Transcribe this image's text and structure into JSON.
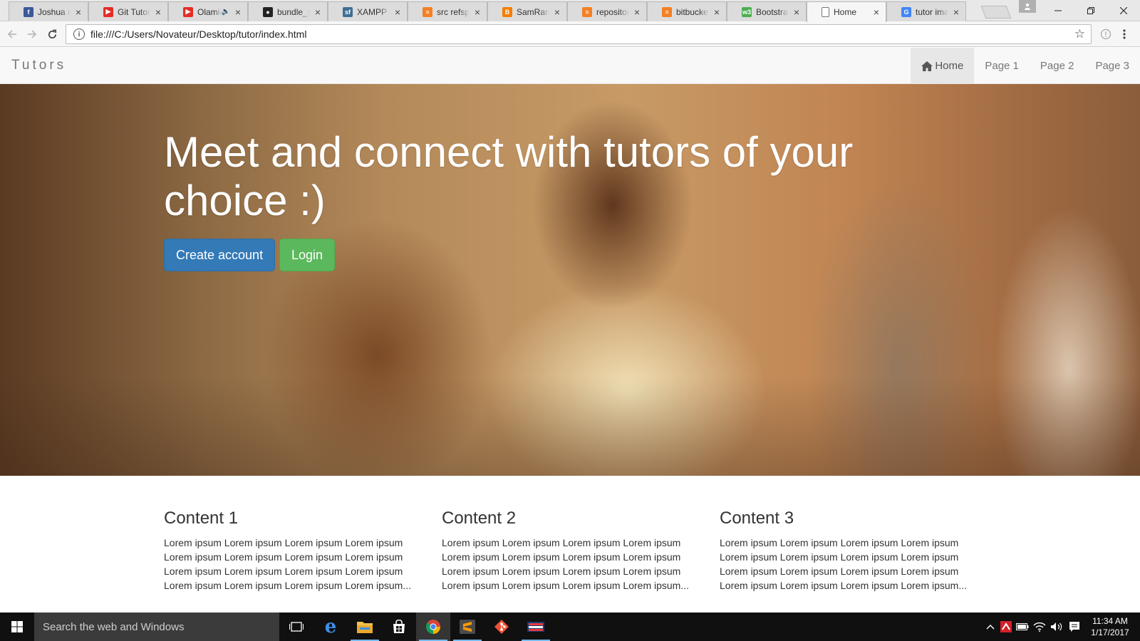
{
  "browser": {
    "tabs": [
      {
        "title": "Joshua m",
        "favicon": "facebook-icon",
        "color": "#3b5998",
        "glyph": "f"
      },
      {
        "title": "Git Tutori",
        "favicon": "youtube-icon",
        "color": "#e52d27",
        "glyph": "▶"
      },
      {
        "title": "Olamic",
        "favicon": "youtube-icon",
        "color": "#e52d27",
        "glyph": "▶",
        "audio": "🔈"
      },
      {
        "title": "bundle_sc",
        "favicon": "github-icon",
        "color": "#222222",
        "glyph": "●"
      },
      {
        "title": "XAMPP | S",
        "favicon": "sourceforge-icon",
        "color": "#3f6e95",
        "glyph": "sf"
      },
      {
        "title": "src refspe",
        "favicon": "stackoverflow-icon",
        "color": "#f48024",
        "glyph": "≡"
      },
      {
        "title": "SamRang",
        "favicon": "blogger-icon",
        "color": "#f57d00",
        "glyph": "B"
      },
      {
        "title": "repositor",
        "favicon": "stackoverflow-icon",
        "color": "#f48024",
        "glyph": "≡"
      },
      {
        "title": "bitbucket",
        "favicon": "stackoverflow-icon",
        "color": "#f48024",
        "glyph": "≡"
      },
      {
        "title": "Bootstrap",
        "favicon": "w3schools-icon",
        "color": "#4caf50",
        "glyph": "w3"
      },
      {
        "title": "Home",
        "favicon": "page-icon",
        "color": "#ffffff",
        "glyph": ""
      },
      {
        "title": "tutor ima",
        "favicon": "google-icon",
        "color": "#4285f4",
        "glyph": "G"
      }
    ],
    "url": "file:///C:/Users/Novateur/Desktop/tutor/index.html"
  },
  "page": {
    "brand": "Tutors",
    "nav": [
      "Home",
      "Page 1",
      "Page 2",
      "Page 3"
    ],
    "hero": {
      "title": "Meet and connect with tutors of your choice :)",
      "create_label": "Create account",
      "login_label": "Login"
    },
    "columns": [
      {
        "heading": "Content 1",
        "body": "Lorem ipsum Lorem ipsum Lorem ipsum Lorem ipsum Lorem ipsum Lorem ipsum Lorem ipsum Lorem ipsum Lorem ipsum Lorem ipsum Lorem ipsum Lorem ipsum Lorem ipsum Lorem ipsum Lorem ipsum Lorem ipsum..."
      },
      {
        "heading": "Content 2",
        "body": "Lorem ipsum Lorem ipsum Lorem ipsum Lorem ipsum Lorem ipsum Lorem ipsum Lorem ipsum Lorem ipsum Lorem ipsum Lorem ipsum Lorem ipsum Lorem ipsum Lorem ipsum Lorem ipsum Lorem ipsum Lorem ipsum..."
      },
      {
        "heading": "Content 3",
        "body": "Lorem ipsum Lorem ipsum Lorem ipsum Lorem ipsum Lorem ipsum Lorem ipsum Lorem ipsum Lorem ipsum Lorem ipsum Lorem ipsum Lorem ipsum Lorem ipsum Lorem ipsum Lorem ipsum Lorem ipsum Lorem ipsum..."
      }
    ]
  },
  "taskbar": {
    "search_placeholder": "Search the web and Windows",
    "apps": [
      "task-view-icon",
      "edge-icon",
      "file-explorer-icon",
      "store-icon",
      "chrome-icon",
      "sublime-text-icon",
      "git-icon",
      "vm-icon"
    ],
    "time": "11:34 AM",
    "date": "1/17/2017"
  },
  "colors": {
    "primary_button": "#337ab7",
    "success_button": "#5cb85c",
    "navbar_bg": "#f8f8f8",
    "taskbar_bg": "#101010"
  }
}
